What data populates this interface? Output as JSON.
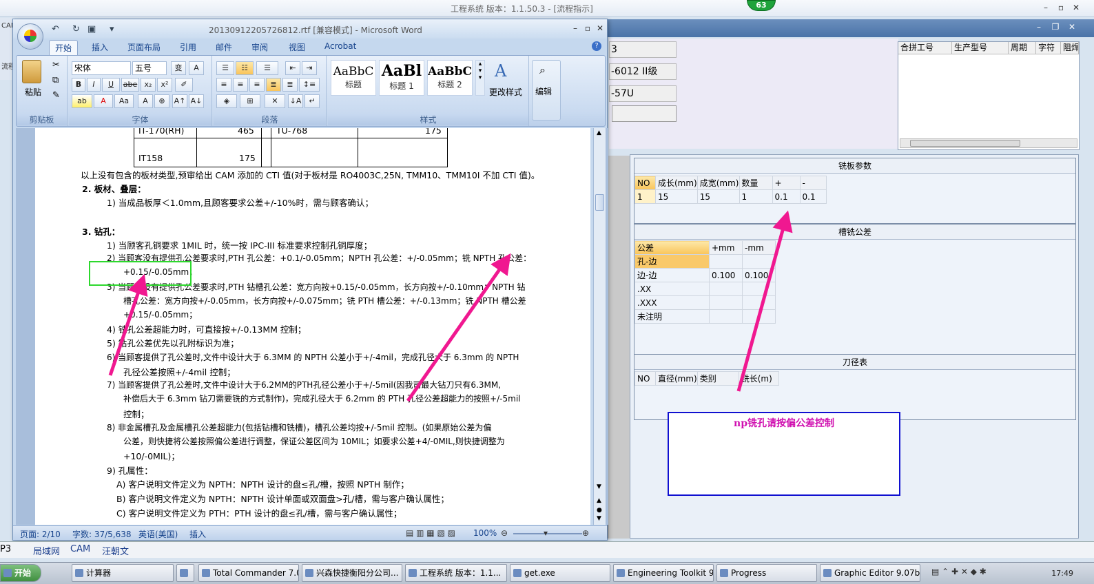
{
  "background_app": {
    "title": "工程系统  版本：1.1.50.3 - [流程指示]",
    "badge": "63",
    "left_labels": [
      "CAM",
      "流程"
    ],
    "info_fields": [
      "3",
      "-6012 II级",
      "-57U"
    ],
    "merge_table": {
      "columns": [
        "合拼工号",
        "生产型号",
        "周期",
        "字符",
        "阻焊"
      ]
    },
    "milling_params": {
      "title": "铣板参数",
      "columns": [
        "NO",
        "成长(mm)",
        "成宽(mm)",
        "数量",
        "+",
        "-"
      ],
      "rows": [
        [
          "1",
          "15",
          "15",
          "1",
          "0.1",
          "0.1"
        ]
      ]
    },
    "slot_tolerance": {
      "title": "槽铣公差",
      "columns": [
        "公差",
        "+mm",
        "-mm"
      ],
      "rows": [
        [
          "孔-边",
          "",
          ""
        ],
        [
          "边-边",
          "0.100",
          "0.100"
        ],
        [
          ".XX",
          "",
          ""
        ],
        [
          ".XXX",
          "",
          ""
        ],
        [
          "未注明",
          "",
          ""
        ]
      ]
    },
    "tool_table": {
      "title": "刀径表",
      "columns": [
        "NO",
        "直径(mm)",
        "类别",
        "铣长(m)"
      ]
    },
    "note": "np铣孔请按偏公差控制",
    "bottom_tabs": [
      "P3",
      "局域网",
      "CAM",
      "汪朝文"
    ]
  },
  "word": {
    "title": "20130912205726812.rtf [兼容模式] - Microsoft Word",
    "tabs": [
      "开始",
      "插入",
      "页面布局",
      "引用",
      "邮件",
      "审阅",
      "视图",
      "Acrobat"
    ],
    "ribbon": {
      "paste": "粘贴",
      "font_name": "宋体",
      "font_size": "五号",
      "groups": [
        "剪贴板",
        "字体",
        "段落",
        "样式"
      ],
      "styles": [
        {
          "sample": "AaBbC",
          "name": "标题"
        },
        {
          "sample": "AaBl",
          "name": "标题 1"
        },
        {
          "sample": "AaBbC",
          "name": "标题 2"
        }
      ],
      "change_styles": "更改样式",
      "edit": "编辑"
    },
    "doc": {
      "table_row1": "IT-170(RH)",
      "table_val1": "465",
      "table_cell1": "TU-768",
      "table_val1b": "175",
      "table_row2": "IT158",
      "table_val2": "175",
      "lines": [
        "以上没有包含的板材类型,预审给出 CAM 添加的 CTI 值(对于板材是 RO4003C,25N, TMM10、TMM10I 不加 CTI 值)。",
        "2.   板材、叠层：",
        "1) 当成品板厚＜1.0mm,且顾客要求公差+/-10%时，需与顾客确认；",
        "3.   钻孔：",
        "1) 当顾客孔铜要求 1MIL 时，统一按 IPC-III 标准要求控制孔铜厚度；",
        "2) 当顾客没有提供孔公差要求时,PTH 孔公差：+0.1/-0.05mm；NPTH 孔公差：+/-0.05mm；铣 NPTH 孔公差：",
        "+0.15/-0.05mm；",
        "3) 当顾客没有提供孔公差要求时,PTH 钻槽孔公差：宽方向按+0.15/-0.05mm，长方向按+/-0.10mm；NPTH 钻",
        "槽孔公差：宽方向按+/-0.05mm，长方向按+/-0.075mm；铣 PTH 槽公差：+/-0.13mm；铣 NPTH 槽公差",
        "+0.15/-0.05mm；",
        "4) 铣孔公差超能力时，可直接按+/-0.13MM 控制；",
        "5) 钻孔公差优先以孔附标识为准；",
        "6) 当顾客提供了孔公差时,文件中设计大于 6.3MM 的 NPTH 公差小于+/-4mil，完成孔径大于 6.3mm 的 NPTH",
        "孔径公差按照+/-4mil 控制；",
        "7) 当顾客提供了孔公差时,文件中设计大于6.2MM的PTH孔径公差小于+/-5mil(因我司最大钻刀只有6.3MM,",
        "补偿后大于 6.3mm 钻刀需要铣的方式制作)，完成孔径大于 6.2mm 的 PTH 孔径公差超能力的按照+/-5mil",
        "控制；",
        "8) 非金属槽孔及金属槽孔公差超能力(包括钻槽和铣槽)，槽孔公差均按+/-5mil 控制。(如果原始公差为偏",
        "公差，则快捷将公差按照偏公差进行调整，保证公差区间为 10MIL；如要求公差+4/-0MIL,则快捷调整为",
        "+10/-0MIL)；",
        "9) 孔属性：",
        "A) 客户说明文件定义为 NPTH：NPTH 设计的盘≤孔/槽，按照 NPTH 制作；",
        "B) 客户说明文件定义为 NPTH：NPTH 设计单面或双面盘>孔/槽，需与客户确认属性；",
        "C) 客户说明文件定义为 PTH：PTH 设计的盘≤孔/槽，需与客户确认属性；"
      ]
    },
    "status": {
      "page": "页面: 2/10",
      "words": "字数: 37/5,638",
      "lang": "英语(美国)",
      "mode": "插入",
      "zoom": "100%"
    }
  },
  "taskbar": {
    "start": "开始",
    "items": [
      "计算器",
      "",
      "Total Commander 7.0 ...",
      "兴森快捷衡阳分公司...",
      "工程系统  版本：1.1...",
      "get.exe",
      "Engineering Toolkit 9.0...",
      "Progress",
      "Graphic Editor 9.07b2 ..."
    ],
    "clock": "17:49"
  },
  "colors": {
    "arrow": "#f01890",
    "note_border": "#1010d0",
    "highlight_box": "#2dd82d"
  }
}
